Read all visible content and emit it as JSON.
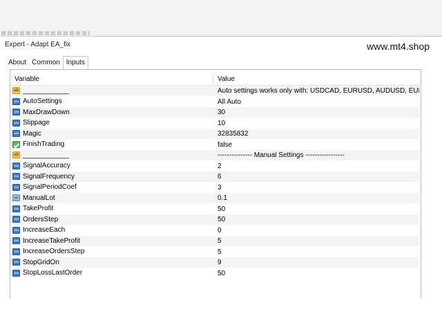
{
  "window": {
    "title": "Expert - Adapt EA_fix",
    "watermark": "www.mt4.shop"
  },
  "tabs": [
    {
      "label": "About"
    },
    {
      "label": "Common"
    },
    {
      "label": "Inputs",
      "active": true
    }
  ],
  "table": {
    "headers": {
      "variable": "Variable",
      "value": "Value"
    },
    "rows": [
      {
        "icon": "text-icon",
        "variable": "____________",
        "value": "Auto settings works only with: USDCAD, EURUSD, AUDUSD, EURG..."
      },
      {
        "icon": "int-icon",
        "variable": "AutoSettings",
        "value": "All Auto"
      },
      {
        "icon": "int-icon",
        "variable": "MaxDrawDown",
        "value": "30"
      },
      {
        "icon": "int-icon",
        "variable": "Slippage",
        "value": "10"
      },
      {
        "icon": "int-icon",
        "variable": "Magic",
        "value": "32835832"
      },
      {
        "icon": "bool-icon",
        "variable": "FinishTrading",
        "value": "false"
      },
      {
        "icon": "text-icon",
        "variable": "____________",
        "value": "---------------  Manual Settings  -----------------"
      },
      {
        "icon": "int-icon",
        "variable": "SignalAccuracy",
        "value": "2"
      },
      {
        "icon": "int-icon",
        "variable": "SignalFrequency",
        "value": "6"
      },
      {
        "icon": "int-icon",
        "variable": "SignalPeriodCoef",
        "value": "3"
      },
      {
        "icon": "double-icon",
        "variable": "ManualLot",
        "value": "0.1"
      },
      {
        "icon": "int-icon",
        "variable": "TakeProfit",
        "value": "50"
      },
      {
        "icon": "int-icon",
        "variable": "OrdersStep",
        "value": "50"
      },
      {
        "icon": "int-icon",
        "variable": "IncreaseEach",
        "value": "0"
      },
      {
        "icon": "int-icon",
        "variable": "IncreaseTakeProfit",
        "value": "5"
      },
      {
        "icon": "int-icon",
        "variable": "IncreaseOrdersStep",
        "value": "5"
      },
      {
        "icon": "int-icon",
        "variable": "StopGridOn",
        "value": "9"
      },
      {
        "icon": "int-icon",
        "variable": "StopLossLastOrder",
        "value": "50"
      }
    ]
  },
  "icon_glyphs": {
    "int": "123",
    "text": "ab",
    "double": "1/2"
  }
}
